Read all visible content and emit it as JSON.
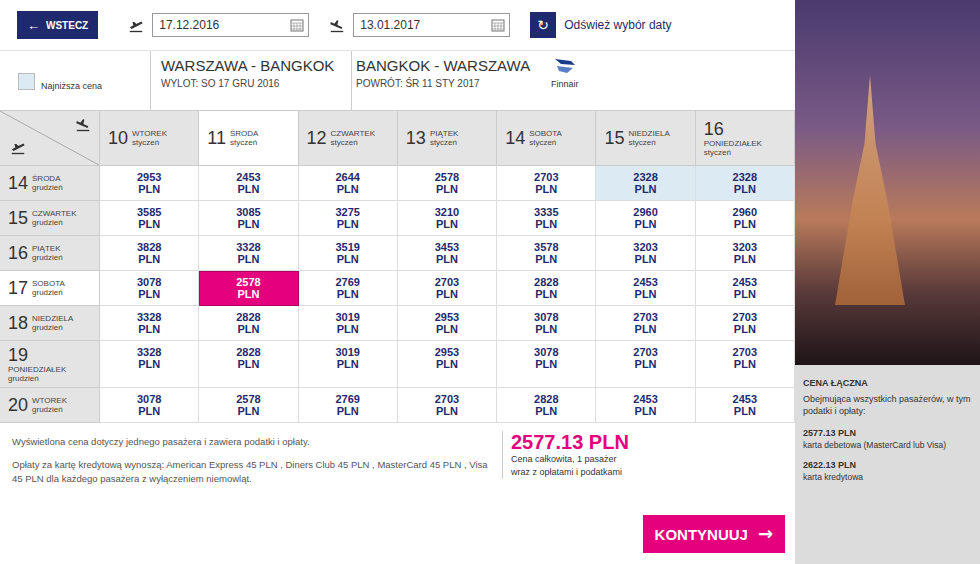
{
  "topbar": {
    "back": "WSTECZ",
    "back_icon": "←",
    "departure_date": "17.12.2016",
    "return_date": "13.01.2017",
    "refresh_icon": "↻",
    "refresh": "Odśwież wybór daty"
  },
  "legend": {
    "label": "Najniższa cena"
  },
  "route": {
    "outbound": {
      "title": "WARSZAWA - BANGKOK",
      "detail": "WYLOT: SO 17 GRU 2016"
    },
    "inbound": {
      "title": "BANGKOK - WARSZAWA",
      "detail": "POWRÓT: ŚR 11 STY 2017"
    },
    "airline": "Finnair"
  },
  "table": {
    "currency": "PLN",
    "columns": [
      {
        "day": "10",
        "weekday": "WTOREK",
        "month": "styczeń",
        "kind": "inline",
        "selected": false
      },
      {
        "day": "11",
        "weekday": "ŚRODA",
        "month": "styczeń",
        "kind": "inline",
        "selected": true
      },
      {
        "day": "12",
        "weekday": "CZWARTEK",
        "month": "styczeń",
        "kind": "inline",
        "selected": false
      },
      {
        "day": "13",
        "weekday": "PIĄTEK",
        "month": "styczeń",
        "kind": "inline",
        "selected": false
      },
      {
        "day": "14",
        "weekday": "SOBOTA",
        "month": "styczeń",
        "kind": "inline",
        "selected": false
      },
      {
        "day": "15",
        "weekday": "NIEDZIELA",
        "month": "styczeń",
        "kind": "inline",
        "selected": false
      },
      {
        "day": "16",
        "weekday": "PONIEDZIAŁEK",
        "month": "styczeń",
        "kind": "stacked",
        "selected": false
      }
    ],
    "rows": [
      {
        "day": "14",
        "weekday": "ŚRODA",
        "month": "grudzień",
        "kind": "inline",
        "selected": false,
        "cells": [
          {
            "price": "2953",
            "selected": false,
            "lowest": false
          },
          {
            "price": "2453",
            "selected": false,
            "lowest": false
          },
          {
            "price": "2644",
            "selected": false,
            "lowest": false
          },
          {
            "price": "2578",
            "selected": false,
            "lowest": false
          },
          {
            "price": "2703",
            "selected": false,
            "lowest": false
          },
          {
            "price": "2328",
            "selected": false,
            "lowest": true
          },
          {
            "price": "2328",
            "selected": false,
            "lowest": true
          }
        ]
      },
      {
        "day": "15",
        "weekday": "CZWARTEK",
        "month": "grudzień",
        "kind": "inline",
        "selected": false,
        "cells": [
          {
            "price": "3585",
            "selected": false,
            "lowest": false
          },
          {
            "price": "3085",
            "selected": false,
            "lowest": false
          },
          {
            "price": "3275",
            "selected": false,
            "lowest": false
          },
          {
            "price": "3210",
            "selected": false,
            "lowest": false
          },
          {
            "price": "3335",
            "selected": false,
            "lowest": false
          },
          {
            "price": "2960",
            "selected": false,
            "lowest": false
          },
          {
            "price": "2960",
            "selected": false,
            "lowest": false
          }
        ]
      },
      {
        "day": "16",
        "weekday": "PIĄTEK",
        "month": "grudzień",
        "kind": "inline",
        "selected": false,
        "cells": [
          {
            "price": "3828",
            "selected": false,
            "lowest": false
          },
          {
            "price": "3328",
            "selected": false,
            "lowest": false
          },
          {
            "price": "3519",
            "selected": false,
            "lowest": false
          },
          {
            "price": "3453",
            "selected": false,
            "lowest": false
          },
          {
            "price": "3578",
            "selected": false,
            "lowest": false
          },
          {
            "price": "3203",
            "selected": false,
            "lowest": false
          },
          {
            "price": "3203",
            "selected": false,
            "lowest": false
          }
        ]
      },
      {
        "day": "17",
        "weekday": "SOBOTA",
        "month": "grudzień",
        "kind": "inline",
        "selected": true,
        "cells": [
          {
            "price": "3078",
            "selected": false,
            "lowest": false
          },
          {
            "price": "2578",
            "selected": true,
            "lowest": false
          },
          {
            "price": "2769",
            "selected": false,
            "lowest": false
          },
          {
            "price": "2703",
            "selected": false,
            "lowest": false
          },
          {
            "price": "2828",
            "selected": false,
            "lowest": false
          },
          {
            "price": "2453",
            "selected": false,
            "lowest": false
          },
          {
            "price": "2453",
            "selected": false,
            "lowest": false
          }
        ]
      },
      {
        "day": "18",
        "weekday": "NIEDZIELA",
        "month": "grudzień",
        "kind": "inline",
        "selected": false,
        "cells": [
          {
            "price": "3328",
            "selected": false,
            "lowest": false
          },
          {
            "price": "2828",
            "selected": false,
            "lowest": false
          },
          {
            "price": "3019",
            "selected": false,
            "lowest": false
          },
          {
            "price": "2953",
            "selected": false,
            "lowest": false
          },
          {
            "price": "3078",
            "selected": false,
            "lowest": false
          },
          {
            "price": "2703",
            "selected": false,
            "lowest": false
          },
          {
            "price": "2703",
            "selected": false,
            "lowest": false
          }
        ]
      },
      {
        "day": "19",
        "weekday": "PONIEDZIAŁEK",
        "month": "grudzień",
        "kind": "stacked",
        "selected": false,
        "cells": [
          {
            "price": "3328",
            "selected": false,
            "lowest": false
          },
          {
            "price": "2828",
            "selected": false,
            "lowest": false
          },
          {
            "price": "3019",
            "selected": false,
            "lowest": false
          },
          {
            "price": "2953",
            "selected": false,
            "lowest": false
          },
          {
            "price": "3078",
            "selected": false,
            "lowest": false
          },
          {
            "price": "2703",
            "selected": false,
            "lowest": false
          },
          {
            "price": "2703",
            "selected": false,
            "lowest": false
          }
        ]
      },
      {
        "day": "20",
        "weekday": "WTOREK",
        "month": "grudzień",
        "kind": "inline",
        "selected": false,
        "cells": [
          {
            "price": "3078",
            "selected": false,
            "lowest": false
          },
          {
            "price": "2578",
            "selected": false,
            "lowest": false
          },
          {
            "price": "2769",
            "selected": false,
            "lowest": false
          },
          {
            "price": "2703",
            "selected": false,
            "lowest": false
          },
          {
            "price": "2828",
            "selected": false,
            "lowest": false
          },
          {
            "price": "2453",
            "selected": false,
            "lowest": false
          },
          {
            "price": "2453",
            "selected": false,
            "lowest": false
          }
        ]
      }
    ]
  },
  "footer": {
    "notes": [
      "Wyświetlona cena dotyczy jednego pasażera i zawiera podatki i opłaty.",
      "Opłaty za kartę kredytową wynoszą: American Express 45 PLN , Diners Club 45 PLN , MasterCard 45 PLN , Visa 45 PLN dla każdego pasażera z wyłączeniem niemowląt."
    ],
    "total": "2577.13 PLN",
    "total_caption": [
      "Cena całkowita, 1 pasażer",
      "wraz z opłatami i podatkami"
    ],
    "button": "KONTYNUUJ",
    "button_icon": "→"
  },
  "summary": {
    "title": "CENA ŁĄCZNA",
    "subtitle": "Obejmująca wszystkich pasażerów, w tym podatki i opłaty:",
    "options": [
      {
        "price": "2577.13 PLN",
        "label": "karta debetowa (MasterCard lub Visa)"
      },
      {
        "price": "2622.13 PLN",
        "label": "karta kredytowa"
      }
    ]
  }
}
